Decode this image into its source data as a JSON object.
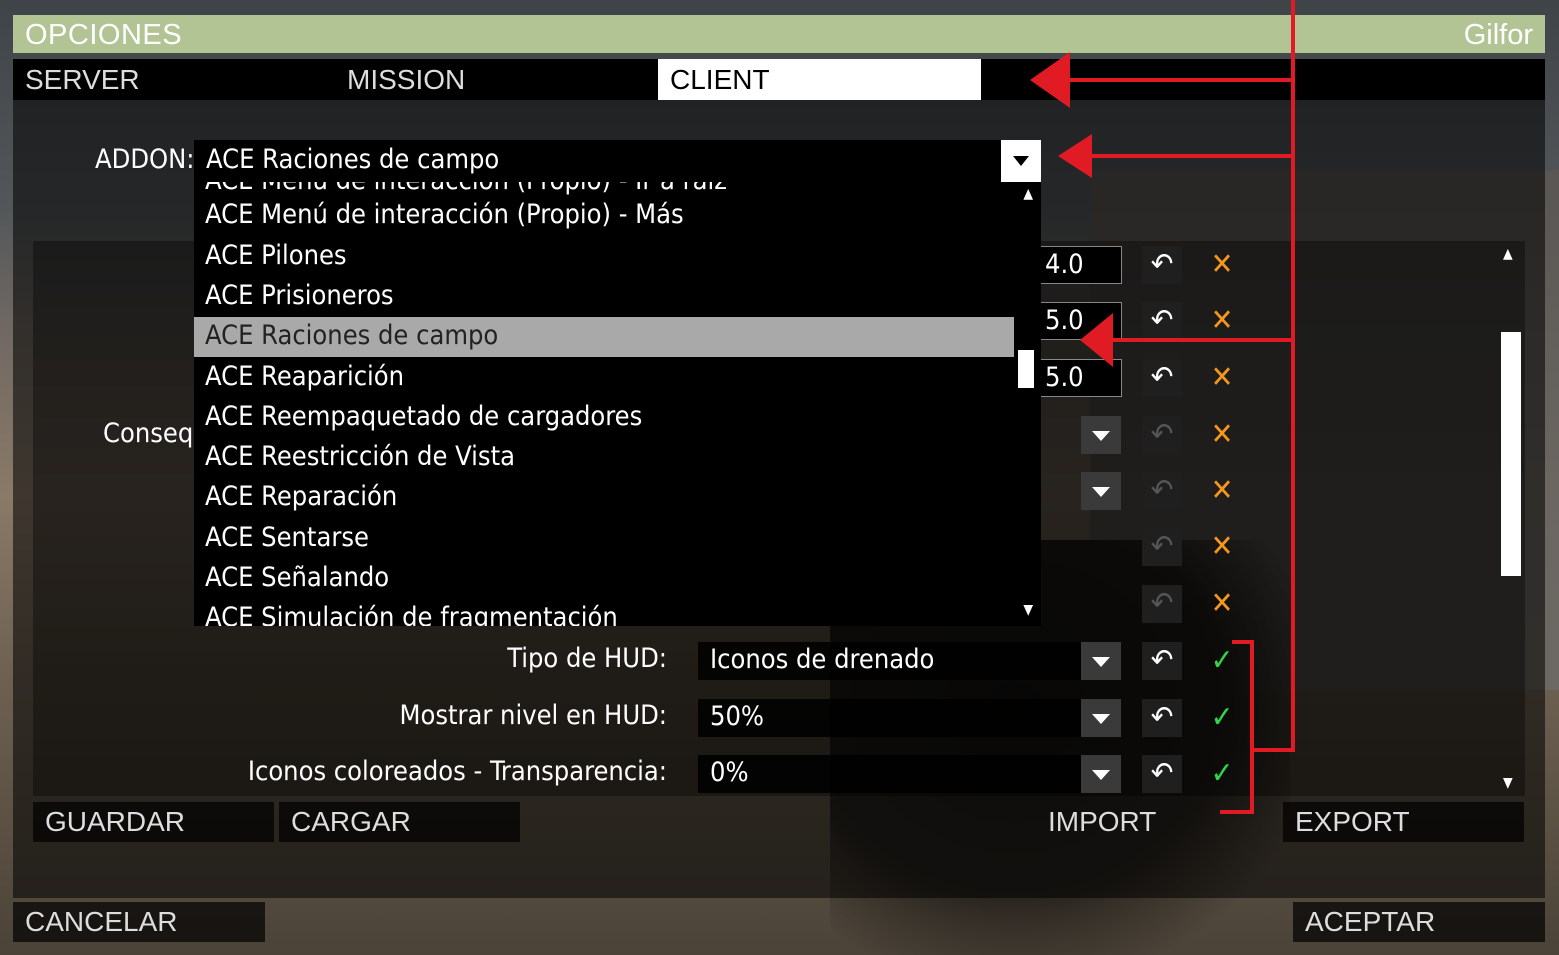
{
  "window": {
    "title": "OPCIONES",
    "user": "Gilfor"
  },
  "tabs": [
    {
      "label": "SERVER",
      "active": false
    },
    {
      "label": "MISSION",
      "active": false
    },
    {
      "label": "CLIENT",
      "active": true
    }
  ],
  "addon": {
    "label": "ADDON:",
    "value": "ACE Raciones de campo"
  },
  "addon_list": {
    "items": [
      "ACE Menú de interacción (Propio) - Ir a raíz",
      "ACE Menú de interacción (Propio) - Más",
      "ACE Pilones",
      "ACE Prisioneros",
      "ACE Raciones de campo",
      "ACE Reaparición",
      "ACE Reempaquetado de cargadores",
      "ACE Reestricción de Vista",
      "ACE Reparación",
      "ACE Sentarse",
      "ACE Señalando",
      "ACE Simulación de fragmentación"
    ],
    "selected": "ACE Raciones de campo"
  },
  "partial_label": "Consequ",
  "numeric_values": [
    "4.0",
    "5.0",
    "5.0"
  ],
  "settings": [
    {
      "label": "Tipo de HUD:",
      "value": "Iconos de drenado"
    },
    {
      "label": "Mostrar nivel en HUD:",
      "value": "50%"
    },
    {
      "label": "Iconos coloreados - Transparencia:",
      "value": "0%"
    }
  ],
  "buttons": {
    "save": "GUARDAR",
    "load": "CARGAR",
    "import": "IMPORT",
    "export": "EXPORT",
    "cancel": "CANCELAR",
    "accept": "ACEPTAR"
  },
  "icons": {
    "undo": "undo-icon",
    "default_marker": "x-icon",
    "changed_marker": "check-icon"
  },
  "colors": {
    "title_bar": "#b2c394",
    "x_mark": "#f5961f",
    "check_mark": "#2ed84a",
    "annotation": "#e01b24"
  }
}
